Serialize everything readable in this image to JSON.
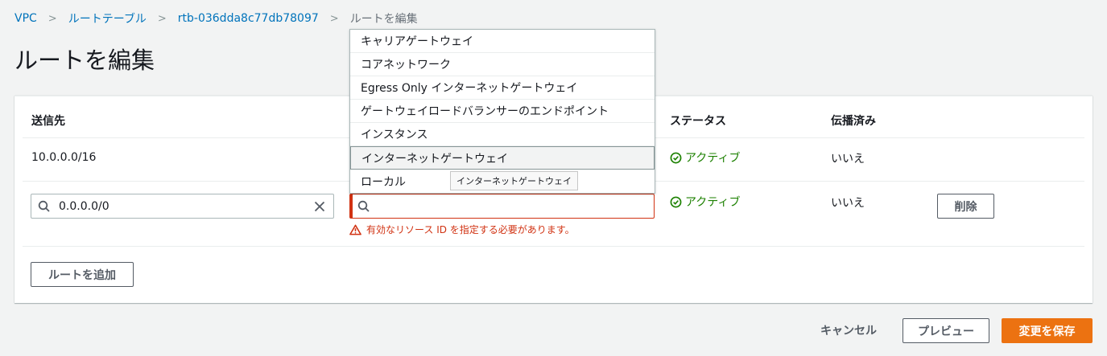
{
  "breadcrumb": {
    "items": [
      "VPC",
      "ルートテーブル",
      "rtb-036dda8c77db78097"
    ],
    "current": "ルートを編集"
  },
  "page": {
    "title": "ルートを編集"
  },
  "table": {
    "headers": {
      "destination": "送信先",
      "status": "ステータス",
      "propagated": "伝播済み"
    },
    "rows": [
      {
        "destination": "10.0.0.0/16",
        "status": "アクティブ",
        "propagated": "いいえ"
      },
      {
        "destination": "0.0.0.0/0",
        "status": "アクティブ",
        "propagated": "いいえ",
        "target": "",
        "remove_label": "削除"
      }
    ],
    "target_error": "有効なリソース ID を指定する必要があります。",
    "add_route_label": "ルートを追加"
  },
  "dropdown": {
    "options": [
      "キャリアゲートウェイ",
      "コアネットワーク",
      "Egress Only インターネットゲートウェイ",
      "ゲートウェイロードバランサーのエンドポイント",
      "インスタンス",
      "インターネットゲートウェイ",
      "ローカル"
    ],
    "highlighted_index": 5
  },
  "tooltip": {
    "text": "インターネットゲートウェイ"
  },
  "footer": {
    "cancel_label": "キャンセル",
    "preview_label": "プレビュー",
    "save_label": "変更を保存"
  },
  "colors": {
    "link": "#0073bb",
    "active": "#1d8102",
    "error": "#d13212",
    "primary": "#ec7211"
  },
  "icons": {
    "search": "search-icon",
    "clear": "close-icon",
    "status": "check-circle-icon",
    "error": "warning-icon"
  }
}
